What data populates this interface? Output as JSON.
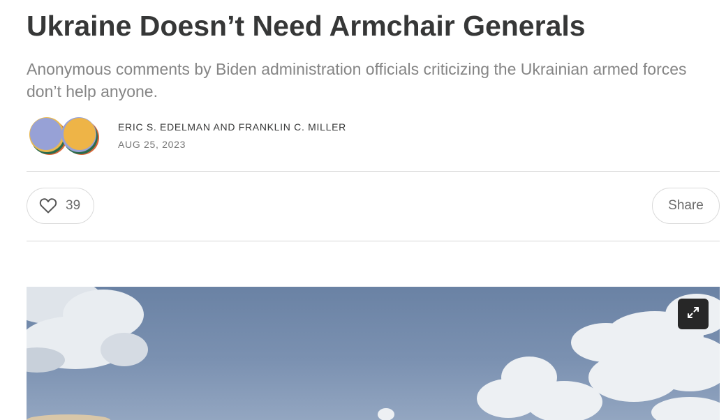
{
  "article": {
    "title": "Ukraine Doesn’t Need Armchair Generals",
    "subtitle": "Anonymous comments by Biden administration officials criticizing the Ukrainian armed forces don’t help anyone.",
    "authors": [
      "Eric S. Edelman",
      "Franklin C. Miller"
    ],
    "author_separator": "and",
    "date": "AUG 25, 2023"
  },
  "actions": {
    "like_count": "39",
    "share_label": "Share"
  },
  "icons": {
    "like": "heart-icon",
    "expand": "expand-icon"
  },
  "colors": {
    "text_primary": "#363737",
    "text_secondary": "#858585",
    "divider": "#d6d6d6",
    "sky": "#7b91b1"
  }
}
